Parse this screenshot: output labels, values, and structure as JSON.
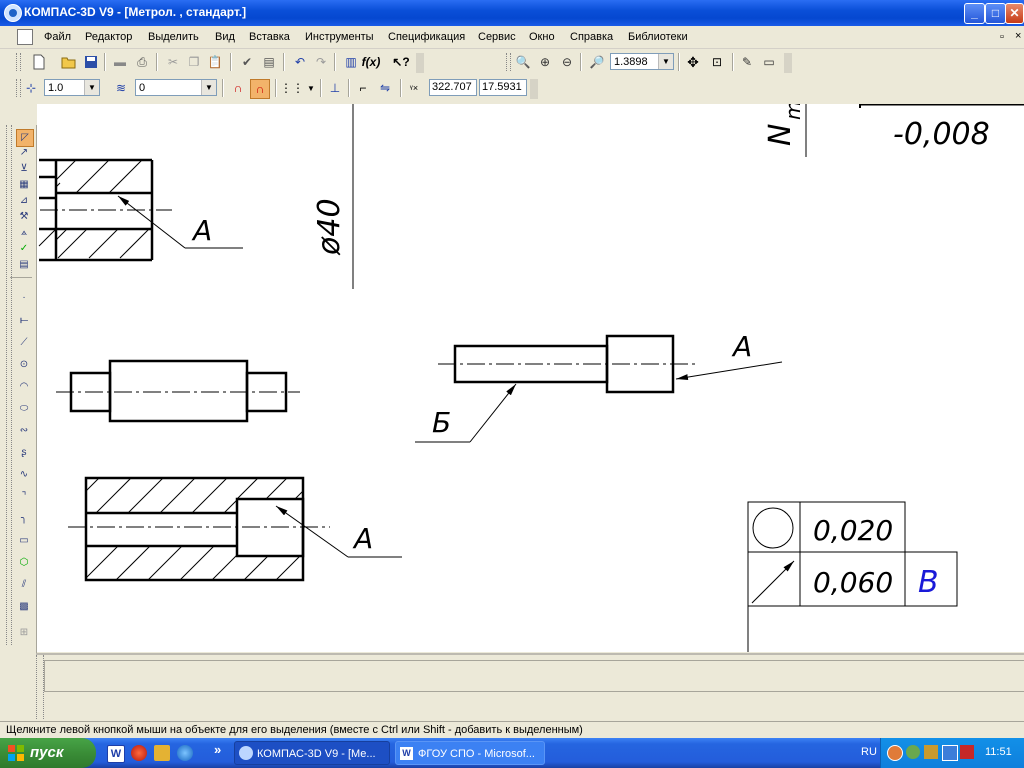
{
  "window": {
    "title": "КОМПАС-3D V9 - [Метрол. , стандарт.]",
    "min_glyph": "_",
    "max_glyph": "□",
    "close_glyph": "✕"
  },
  "menu": [
    "Файл",
    "Редактор",
    "Выделить",
    "Вид",
    "Вставка",
    "Инструменты",
    "Спецификация",
    "Сервис",
    "Окно",
    "Справка",
    "Библиотеки"
  ],
  "menu_underline": [
    "Ф",
    "Р",
    "В",
    "В",
    "В",
    "И",
    "С",
    "С",
    "О",
    "С",
    "Б"
  ],
  "toolbar": {
    "zoom_value": "1.3898",
    "style_value": "1.0",
    "layer_value": "0",
    "coord_x": "322.707",
    "coord_y": "17.5931",
    "fx_label": "f(x)"
  },
  "drawing": {
    "diameter_label": "ø40",
    "tolerance_value": "-0,008",
    "n_label": "N",
    "n_sub": "ma",
    "label_a": "A",
    "label_b": "Б",
    "frame_round": "0,020",
    "frame_runout": "0,060",
    "frame_base": "B"
  },
  "status_text": "Щелкните левой кнопкой мыши на объекте для его выделения (вместе с Ctrl или Shift - добавить к выделенным)",
  "taskbar": {
    "start_label": "пуск",
    "tasks": [
      "КОМПАС-3D V9 - [Ме...",
      "ФГОУ СПО - Microsof..."
    ],
    "lang": "RU",
    "clock": "11:51",
    "chevron": "»"
  },
  "colors": {
    "titlebar": "#0a4fd8",
    "taskbar": "#245ddb",
    "start": "#3a8d37",
    "base_letter": "#1a1ad8"
  }
}
